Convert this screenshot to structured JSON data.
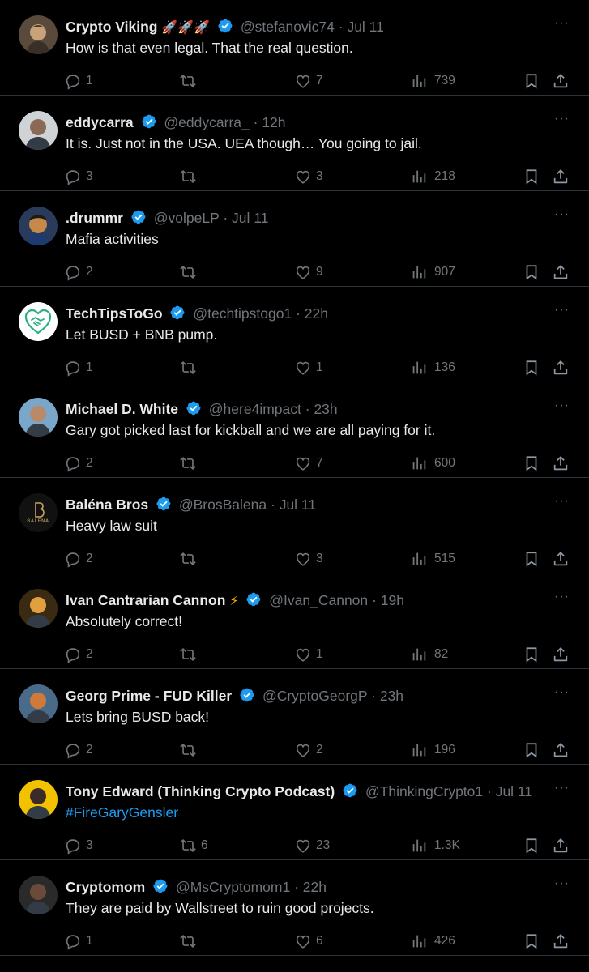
{
  "colors": {
    "background": "#000000",
    "text": "#e7e9ea",
    "muted": "#71767b",
    "link": "#1d9bf0",
    "verified": "#1d9bf0",
    "divider": "#2f3336"
  },
  "icons": {
    "more": "more-icon",
    "reply": "reply-icon",
    "retweet": "retweet-icon",
    "like": "heart-icon",
    "views": "views-icon",
    "bookmark": "bookmark-icon",
    "share": "share-icon",
    "verified": "verified-badge-icon"
  },
  "more_glyph": "···",
  "separator": "·",
  "tweets": [
    {
      "name": "Crypto Viking",
      "emoji": "🚀🚀🚀",
      "emoji_kind": "rocket",
      "handle": "@stefanovic74",
      "time": "Jul 11",
      "text": "How is that even legal. That the real question.",
      "link": false,
      "replies": "1",
      "retweets": "",
      "likes": "7",
      "views": "739"
    },
    {
      "name": "eddycarra",
      "emoji": "",
      "emoji_kind": "",
      "handle": "@eddycarra_",
      "time": "12h",
      "text": "It is. Just not in the USA. UEA though… You going to jail.",
      "link": false,
      "replies": "3",
      "retweets": "",
      "likes": "3",
      "views": "218"
    },
    {
      "name": ".drummr",
      "emoji": "",
      "emoji_kind": "",
      "handle": "@volpeLP",
      "time": "Jul 11",
      "text": "Mafia activities",
      "link": false,
      "replies": "2",
      "retweets": "",
      "likes": "9",
      "views": "907"
    },
    {
      "name": "TechTipsToGo",
      "emoji": "",
      "emoji_kind": "",
      "handle": "@techtipstogo1",
      "time": "22h",
      "text": "Let BUSD + BNB pump.",
      "link": false,
      "replies": "1",
      "retweets": "",
      "likes": "1",
      "views": "136"
    },
    {
      "name": "Michael D. White",
      "emoji": "",
      "emoji_kind": "",
      "handle": "@here4impact",
      "time": "23h",
      "text": "Gary got picked last for kickball and we are all paying for it.",
      "link": false,
      "replies": "2",
      "retweets": "",
      "likes": "7",
      "views": "600"
    },
    {
      "name": "Baléna Bros",
      "emoji": "",
      "emoji_kind": "",
      "handle": "@BrosBalena",
      "time": "Jul 11",
      "text": "Heavy law suit",
      "link": false,
      "replies": "2",
      "retweets": "",
      "likes": "3",
      "views": "515"
    },
    {
      "name": "Ivan Cantrarian Cannon",
      "emoji": "⚡",
      "emoji_kind": "bolt",
      "handle": "@Ivan_Cannon",
      "time": "19h",
      "text": "Absolutely correct!",
      "link": false,
      "replies": "2",
      "retweets": "",
      "likes": "1",
      "views": "82"
    },
    {
      "name": "Georg Prime - FUD Killer",
      "emoji": "",
      "emoji_kind": "",
      "handle": "@CryptoGeorgP",
      "time": "23h",
      "text": "Lets bring BUSD back!",
      "link": false,
      "replies": "2",
      "retweets": "",
      "likes": "2",
      "views": "196"
    },
    {
      "name": "Tony Edward (Thinking Crypto Podcast)",
      "emoji": "",
      "emoji_kind": "",
      "handle": "@ThinkingCrypto1",
      "time": "Jul 11",
      "text": "#FireGaryGensler",
      "link": true,
      "replies": "3",
      "retweets": "6",
      "likes": "23",
      "views": "1.3K"
    },
    {
      "name": "Cryptomom",
      "emoji": "",
      "emoji_kind": "",
      "handle": "@MsCryptomom1",
      "time": "22h",
      "text": "They are paid by Wallstreet to ruin good projects.",
      "link": false,
      "replies": "1",
      "retweets": "",
      "likes": "6",
      "views": "426"
    }
  ],
  "avatars": [
    {
      "kind": "viking",
      "bg": "#5a4a3c",
      "fg": "#c9a27a"
    },
    {
      "kind": "person",
      "bg": "#cfd3d6",
      "fg": "#8a6a55"
    },
    {
      "kind": "cartoon",
      "bg": "#2a3a5a",
      "fg": "#c58a4a"
    },
    {
      "kind": "handshake",
      "bg": "#ffffff",
      "fg": "#2bb07f"
    },
    {
      "kind": "person",
      "bg": "#7aa7c9",
      "fg": "#b88a6a"
    },
    {
      "kind": "logo",
      "bg": "#111111",
      "fg": "#c9a25a",
      "logo_text": "BALÉNA"
    },
    {
      "kind": "person",
      "bg": "#3a2a12",
      "fg": "#e0a040"
    },
    {
      "kind": "person",
      "bg": "#4a6a8a",
      "fg": "#d07a3a"
    },
    {
      "kind": "person",
      "bg": "#f2c200",
      "fg": "#3a2a2a"
    },
    {
      "kind": "person",
      "bg": "#2a2a2a",
      "fg": "#6a4a3a"
    }
  ]
}
